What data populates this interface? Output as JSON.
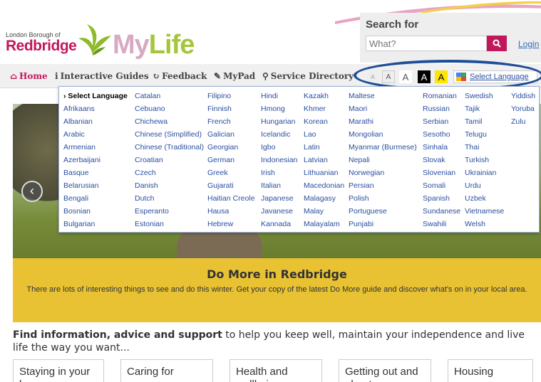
{
  "header": {
    "borough_text": "London Borough of",
    "redbridge": "Redbridge",
    "my": "My",
    "life": "Life",
    "search_title": "Search for",
    "search_placeholder": "What?",
    "login": "Login",
    "brand_color": "#c2185b",
    "accent_green": "#a5c63b"
  },
  "nav": {
    "items": [
      {
        "icon": "home-icon",
        "label": "Home"
      },
      {
        "icon": "info-icon",
        "label": "Interactive Guides"
      },
      {
        "icon": "refresh-icon",
        "label": "Feedback"
      },
      {
        "icon": "edit-icon",
        "label": "MyPad"
      },
      {
        "icon": "location-pin-icon",
        "label": "Service Directory"
      }
    ],
    "text_sizes": [
      "A",
      "A",
      "A",
      "A",
      "A"
    ],
    "select_language": "Select Language"
  },
  "language_menu": {
    "columns": [
      [
        "› Select Language",
        "Afrikaans",
        "Albanian",
        "Arabic",
        "Armenian",
        "Azerbaijani",
        "Basque",
        "Belarusian",
        "Bengali",
        "Bosnian",
        "Bulgarian"
      ],
      [
        "Catalan",
        "Cebuano",
        "Chichewa",
        "Chinese (Simplified)",
        "Chinese (Traditional)",
        "Croatian",
        "Czech",
        "Danish",
        "Dutch",
        "Esperanto",
        "Estonian"
      ],
      [
        "Filipino",
        "Finnish",
        "French",
        "Galician",
        "Georgian",
        "German",
        "Greek",
        "Gujarati",
        "Haitian Creole",
        "Hausa",
        "Hebrew"
      ],
      [
        "Hindi",
        "Hmong",
        "Hungarian",
        "Icelandic",
        "Igbo",
        "Indonesian",
        "Irish",
        "Italian",
        "Japanese",
        "Javanese",
        "Kannada"
      ],
      [
        "Kazakh",
        "Khmer",
        "Korean",
        "Lao",
        "Latin",
        "Latvian",
        "Lithuanian",
        "Macedonian",
        "Malagasy",
        "Malay",
        "Malayalam"
      ],
      [
        "Maltese",
        "Maori",
        "Marathi",
        "Mongolian",
        "Myanmar (Burmese)",
        "Nepali",
        "Norwegian",
        "Persian",
        "Polish",
        "Portuguese",
        "Punjabi"
      ],
      [
        "Romanian",
        "Russian",
        "Serbian",
        "Sesotho",
        "Sinhala",
        "Slovak",
        "Slovenian",
        "Somali",
        "Spanish",
        "Sundanese",
        "Swahili"
      ],
      [
        "Swedish",
        "Tajik",
        "Tamil",
        "Telugu",
        "Thai",
        "Turkish",
        "Ukrainian",
        "Urdu",
        "Uzbek",
        "Vietnamese",
        "Welsh"
      ],
      [
        "Yiddish",
        "Yoruba",
        "Zulu"
      ]
    ]
  },
  "hero": {
    "title": "Do More in Redbridge",
    "text": "There are lots of interesting things to see and do this winter. Get your copy of the latest Do More guide and discover what's on in your local area."
  },
  "info": {
    "bold": "Find information, advice and support",
    "rest": " to help you keep well, maintain your independence and live life the way you want..."
  },
  "tiles": [
    "Staying in your home",
    "Caring for someone",
    "Health and wellbeing",
    "Getting out and about",
    "Housing"
  ]
}
